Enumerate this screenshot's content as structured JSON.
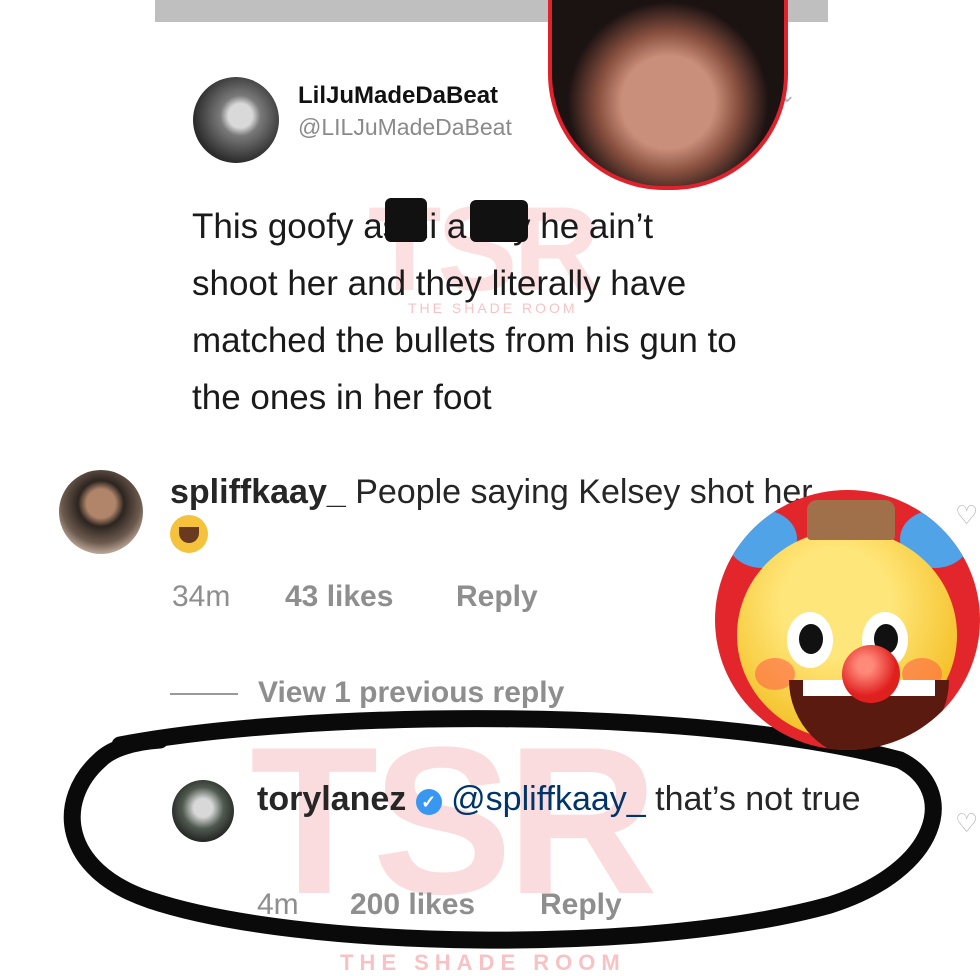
{
  "tweet": {
    "display_name": "LilJuMadeDaBeat",
    "handle": "@LILJuMadeDaBeat",
    "text_line1": "This goofy as   ni   a say he ain’t",
    "text_line2": "shoot her and they literally have",
    "text_line3": "matched the bullets from his gun to",
    "text_line4": "the ones in her foot"
  },
  "watermark": {
    "logo": "TSR",
    "tagline": "THE SHADE ROOM"
  },
  "comment1": {
    "username": "spliffkaay_",
    "text": "People saying Kelsey shot her",
    "time": "34m",
    "likes": "43 likes",
    "reply": "Reply"
  },
  "view_replies": "View 1 previous reply",
  "comment2": {
    "username": "torylanez",
    "mention": "@spliffkaay_",
    "text": "that’s not true",
    "time": "4m",
    "likes": "200 likes",
    "reply": "Reply"
  },
  "icons": {
    "verified": "verified-badge-icon",
    "like": "heart-icon",
    "clown": "clown-emoji",
    "cry": "loudly-crying-emoji"
  },
  "colors": {
    "accent_red": "#e0222c",
    "verified_blue": "#3897f0",
    "muted_text": "#8e8e8e"
  }
}
